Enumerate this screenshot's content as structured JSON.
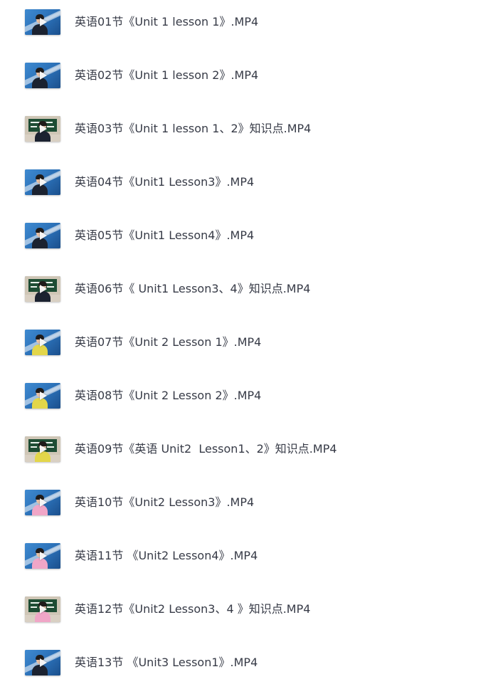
{
  "files": [
    {
      "name": "英语01节《Unit 1 lesson 1》.MP4",
      "thumb_style": "blue-man"
    },
    {
      "name": "英语02节《Unit 1 lesson 2》.MP4",
      "thumb_style": "blue-man"
    },
    {
      "name": "英语03节《Unit 1 lesson 1、2》知识点.MP4",
      "thumb_style": "classroom"
    },
    {
      "name": "英语04节《Unit1 Lesson3》.MP4",
      "thumb_style": "blue-man"
    },
    {
      "name": "英语05节《Unit1 Lesson4》.MP4",
      "thumb_style": "blue-man"
    },
    {
      "name": "英语06节《 Unit1 Lesson3、4》知识点.MP4",
      "thumb_style": "classroom"
    },
    {
      "name": "英语07节《Unit 2 Lesson 1》.MP4",
      "thumb_style": "blue-yellow"
    },
    {
      "name": "英语08节《Unit 2 Lesson 2》.MP4",
      "thumb_style": "blue-yellow"
    },
    {
      "name": "英语09节《英语 Unit2  Lesson1、2》知识点.MP4",
      "thumb_style": "classroom-yellow"
    },
    {
      "name": "英语10节《Unit2 Lesson3》.MP4",
      "thumb_style": "blue-pink"
    },
    {
      "name": "英语11节 《Unit2 Lesson4》.MP4",
      "thumb_style": "blue-pink"
    },
    {
      "name": "英语12节《Unit2 Lesson3、4 》知识点.MP4",
      "thumb_style": "classroom-pink"
    },
    {
      "name": "英语13节 《Unit3 Lesson1》.MP4",
      "thumb_style": "blue-man"
    }
  ],
  "icons": {
    "thumbnail_overlay": "play-icon"
  },
  "colors": {
    "text": "#373b47",
    "thumb_blue": "#2a6fb6",
    "board_green": "#1e4d34",
    "shirt_yellow": "#e3d64a",
    "shirt_pink": "#f0a6c7",
    "suit_dark": "#1b2230"
  }
}
